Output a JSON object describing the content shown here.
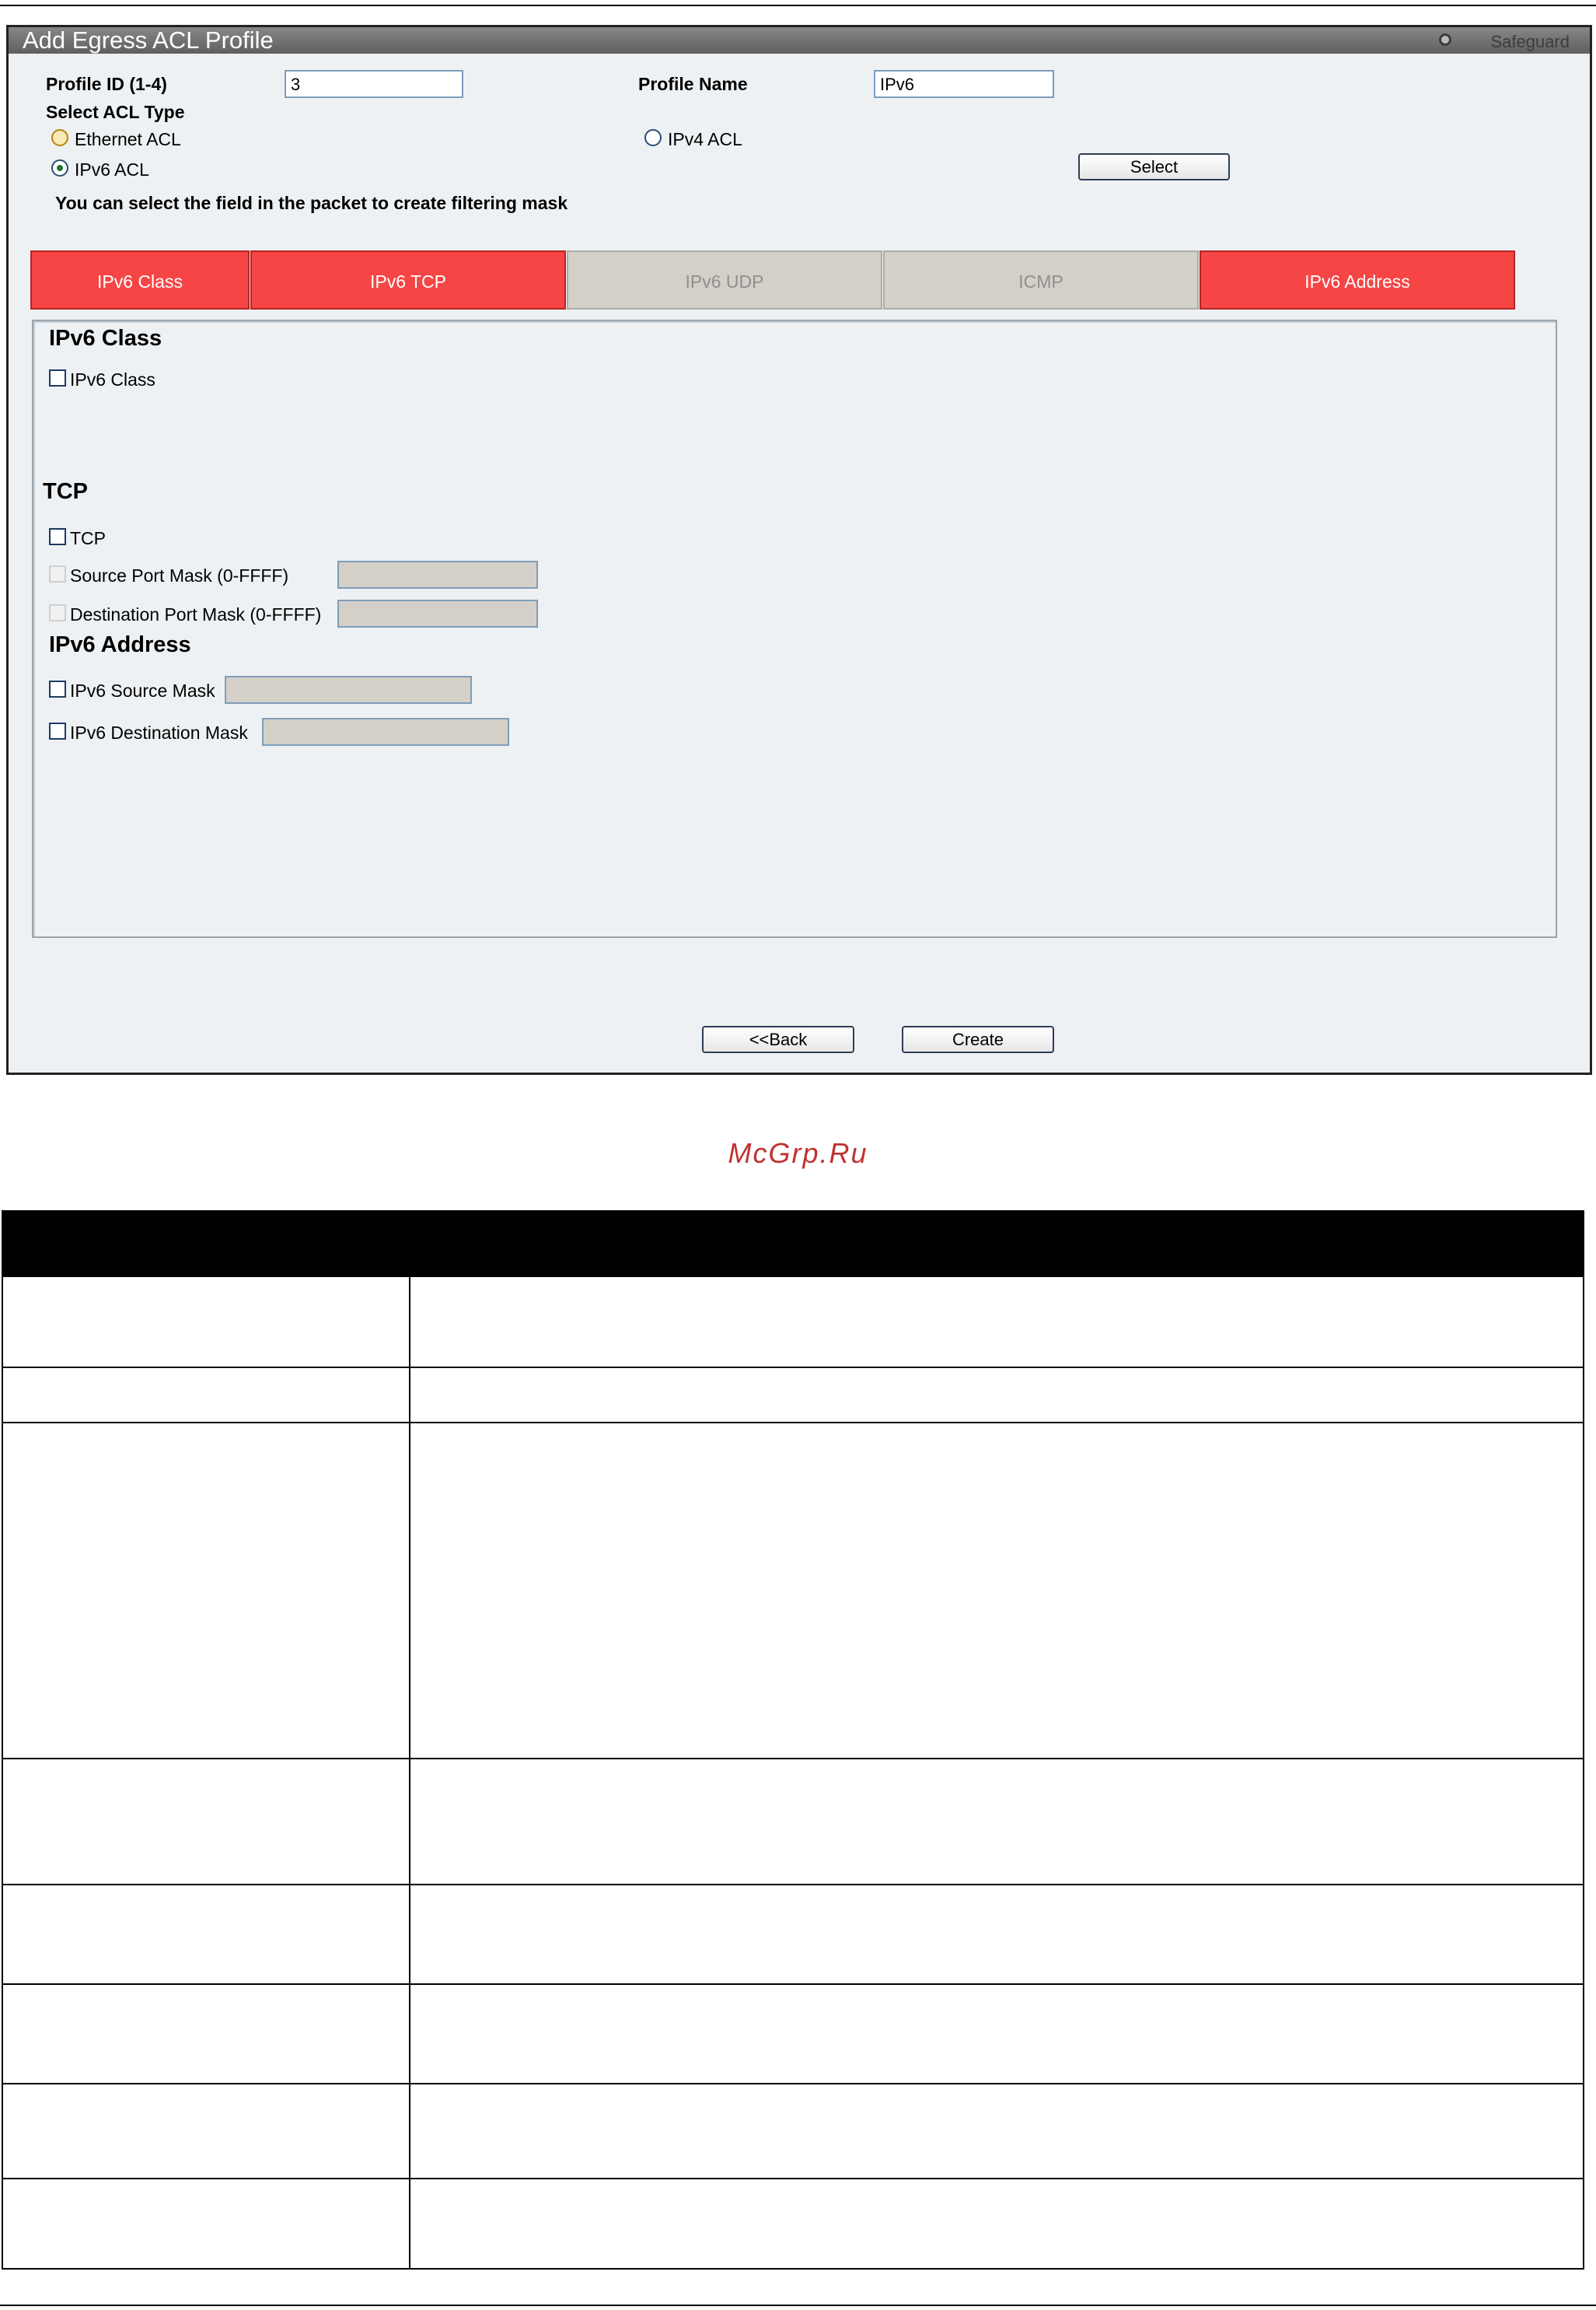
{
  "window": {
    "title": "Add Egress ACL Profile",
    "safeguard": "Safeguard"
  },
  "form": {
    "profile_id_label": "Profile ID (1-4)",
    "profile_id_value": "3",
    "profile_name_label": "Profile Name",
    "profile_name_value": "IPv6",
    "select_acl_type_label": "Select ACL Type",
    "acl_types": {
      "ethernet": "Ethernet ACL",
      "ipv4": "IPv4 ACL",
      "ipv6": "IPv6 ACL",
      "selected": "IPv6 ACL"
    },
    "select_button": "Select",
    "hint": "You can select the field in the packet to create filtering mask"
  },
  "tabs": [
    {
      "label": "IPv6 Class",
      "state": "selected"
    },
    {
      "label": "IPv6 TCP",
      "state": "selected"
    },
    {
      "label": "IPv6 UDP",
      "state": "disabled"
    },
    {
      "label": "ICMP",
      "state": "disabled"
    },
    {
      "label": "IPv6 Address",
      "state": "selected"
    }
  ],
  "sections": {
    "ipv6_class": {
      "heading": "IPv6 Class",
      "checkbox_label": "IPv6 Class"
    },
    "tcp": {
      "heading": "TCP",
      "checkbox_label": "TCP",
      "source_port_mask_label": "Source Port Mask (0-FFFF)",
      "destination_port_mask_label": "Destination Port Mask (0-FFFF)"
    },
    "ipv6_address": {
      "heading": "IPv6 Address",
      "source_mask_label": "IPv6 Source Mask",
      "destination_mask_label": "IPv6 Destination Mask"
    }
  },
  "buttons": {
    "back": "<<Back",
    "create": "Create"
  },
  "watermark": "McGrp.Ru",
  "colors": {
    "tab_selected": "#f54545",
    "tab_disabled": "#d3d0c8",
    "title_bar": "#6e6e6e",
    "panel_bg": "#eef1f3"
  }
}
